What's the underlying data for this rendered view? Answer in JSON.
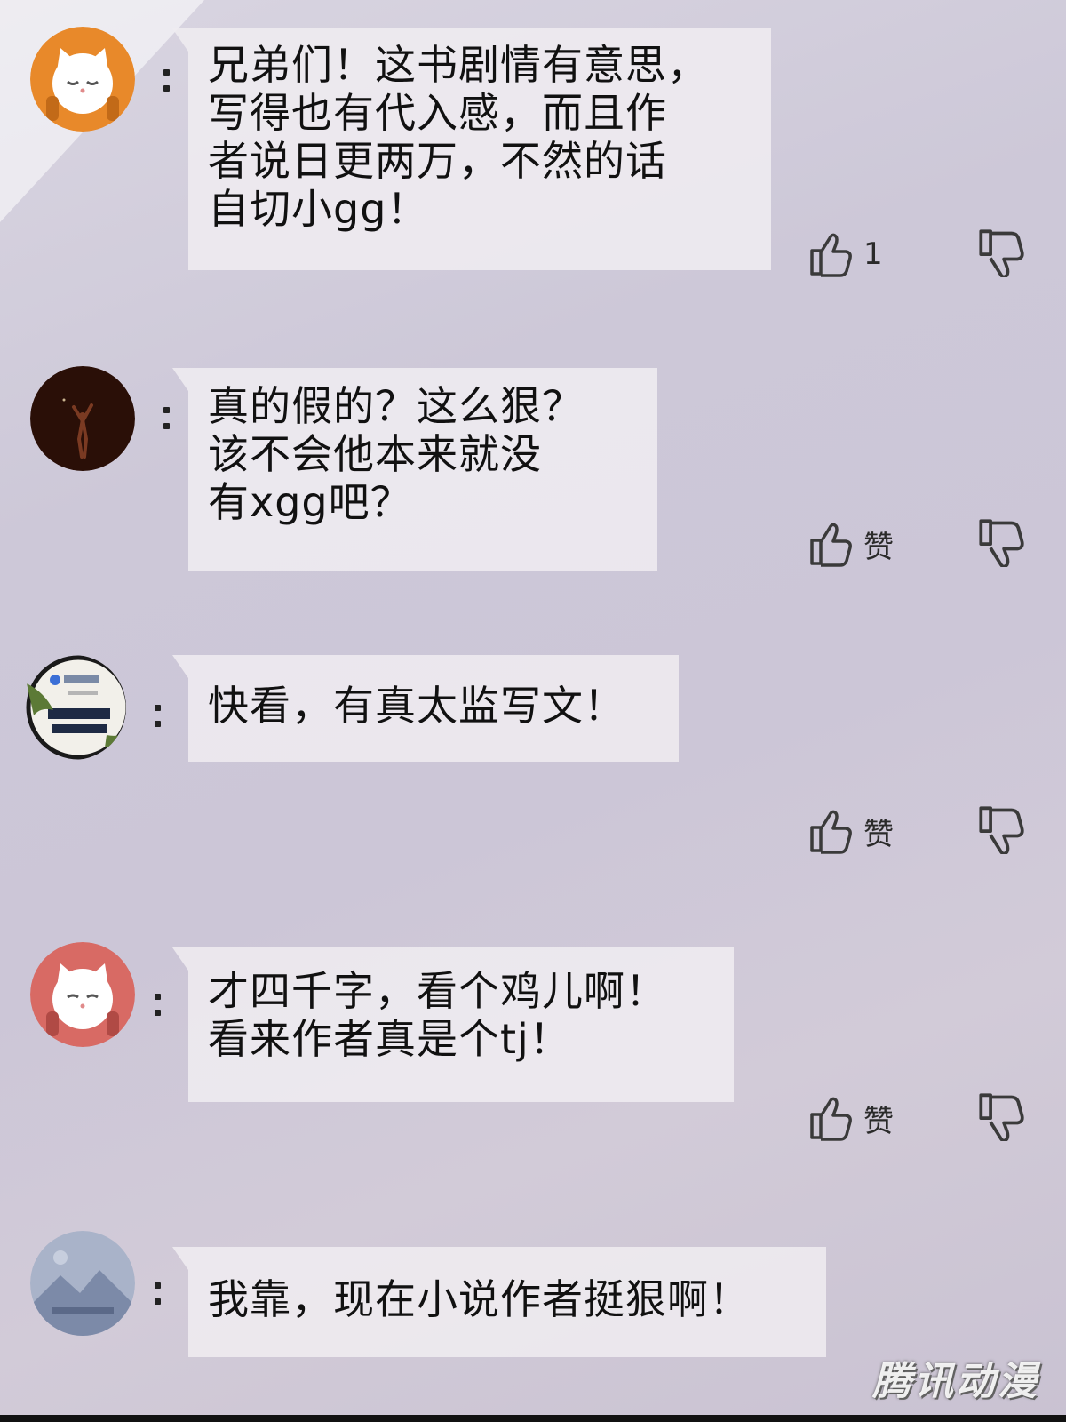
{
  "comments": [
    {
      "lines": [
        "兄弟们！这书剧情有意思，",
        "写得也有代入感，而且作",
        "者说日更两万，不然的话",
        "自切小gg！"
      ],
      "like_label": "1"
    },
    {
      "lines": [
        "真的假的？这么狠？",
        "该不会他本来就没",
        "有xgg吧？"
      ],
      "like_label": "赞"
    },
    {
      "lines": [
        "快看，有真太监写文！"
      ],
      "like_label": "赞"
    },
    {
      "lines": [
        "才四千字，看个鸡儿啊！",
        "看来作者真是个tj！"
      ],
      "like_label": "赞"
    },
    {
      "lines": [
        "我靠，现在小说作者挺狠啊！"
      ]
    }
  ],
  "avatars": [
    "cat-avatar-orange",
    "dark-figure-avatar",
    "qq-logo-avatar",
    "cat-avatar-red",
    "landscape-placeholder-avatar"
  ],
  "colors": {
    "orange_avatar": "#e8892a",
    "red_avatar": "#d86a64",
    "dark_avatar": "#2a0f07",
    "bubble": "#efecf0",
    "icon": "#3a3a3a"
  },
  "icons": {
    "like": "thumbs-up-icon",
    "dislike": "thumbs-down-icon"
  },
  "watermark": "腾讯动漫"
}
